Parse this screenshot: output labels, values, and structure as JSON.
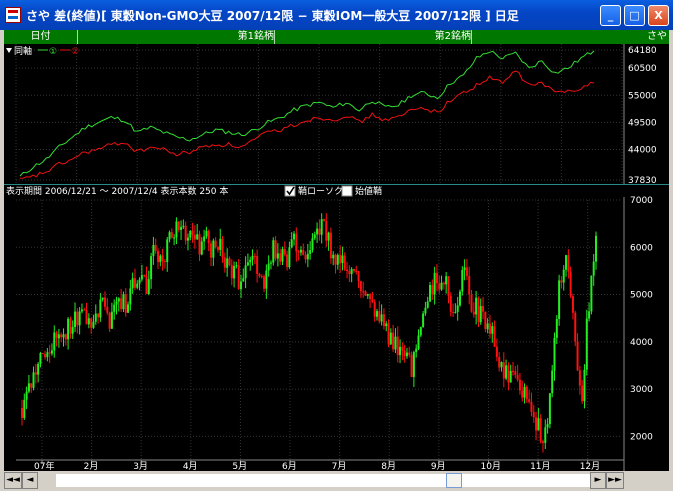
{
  "window": {
    "title": "さや 差(終値)[ 東穀Non-GMO大豆 2007/12限 − 東穀IOM一般大豆 2007/12限 ] 日足",
    "btn_minimize": "_",
    "btn_maximize": "□",
    "btn_close": "X"
  },
  "header": {
    "col_date": "日付",
    "col_first": "第1銘柄",
    "col_second": "第2銘柄",
    "col_spread": "さや"
  },
  "upper_chart": {
    "legend": "同軸",
    "legend_series1": "①",
    "legend_series2": "②",
    "y_ticks": [
      "64180",
      "60500",
      "55000",
      "49500",
      "44000",
      "37830"
    ]
  },
  "lower_chart": {
    "period_text": "表示期間 2006/12/21 〜 2007/12/4 表示本数 250 本",
    "candlestick_label": "鞘ローソク",
    "candlestick_checked": true,
    "start_value_label": "始値鞘",
    "start_value_checked": false,
    "y_ticks": [
      "7000",
      "6000",
      "5000",
      "4000",
      "3000",
      "2000"
    ],
    "x_labels": [
      "07年",
      "2月",
      "3月",
      "4月",
      "5月",
      "6月",
      "7月",
      "8月",
      "9月",
      "10月",
      "11月",
      "12月"
    ]
  },
  "colors": {
    "series1": "#33dd33",
    "series2": "#ee1111",
    "up_candle": "#22ee22",
    "down_candle": "#ff1111",
    "header_bg": "#007800"
  },
  "chart_data": [
    {
      "type": "line",
      "series": [
        {
          "name": "①",
          "values": [
            38500,
            40500,
            42000,
            44500,
            46500,
            48500,
            49500,
            50500,
            50000,
            47500,
            48500,
            47500,
            46500,
            46000,
            47000,
            48000,
            47500,
            47000,
            48000,
            49500,
            50500,
            52000,
            53000,
            53500,
            52500,
            53500,
            52000,
            54000,
            52500,
            53000,
            55000,
            55500,
            54500,
            57500,
            59000,
            62500,
            64000,
            62500,
            63500,
            60500,
            62000,
            59500,
            60500,
            62500,
            64000
          ]
        },
        {
          "name": "②",
          "values": [
            37800,
            38500,
            39500,
            41000,
            42000,
            43500,
            44000,
            45000,
            45500,
            43500,
            44500,
            44000,
            43000,
            43500,
            44500,
            45000,
            45000,
            44500,
            46000,
            47500,
            48000,
            49000,
            50000,
            50500,
            50000,
            51000,
            49500,
            51000,
            50000,
            50500,
            52000,
            52500,
            51500,
            54000,
            55500,
            57000,
            58500,
            57500,
            60000,
            57000,
            57500,
            55500,
            56000,
            56500,
            57500
          ]
        }
      ],
      "ylim": [
        37830,
        64180
      ]
    },
    {
      "type": "line",
      "categories": [
        "07年",
        "2月",
        "3月",
        "4月",
        "5月",
        "6月",
        "7月",
        "8月",
        "9月",
        "10月",
        "11月",
        "12月"
      ],
      "series": [
        {
          "name": "さや",
          "values": [
            2600,
            3000,
            3500,
            3700,
            3900,
            4200,
            4300,
            4400,
            4600,
            4500,
            4600,
            4700,
            4400,
            5000,
            4800,
            5100,
            5400,
            5000,
            6200,
            5500,
            6300,
            6400,
            6300,
            6200,
            6000,
            6200,
            5900,
            6000,
            5600,
            5400,
            5300,
            5700,
            5500,
            5300,
            6000,
            5800,
            5700,
            6100,
            5900,
            5900,
            6200,
            6500,
            5900,
            5700,
            5500,
            5400,
            5100,
            4800,
            4600,
            4300,
            4100,
            3800,
            3600,
            3500,
            4200,
            4800,
            5200,
            5400,
            5000,
            4400,
            5600,
            4900,
            4600,
            4400,
            4300,
            3400,
            3300,
            3500,
            3000,
            2800,
            2300,
            1800,
            3100,
            5200,
            5700,
            4500,
            2600,
            4800,
            6100
          ]
        }
      ],
      "ylim": [
        1500,
        7000
      ]
    }
  ]
}
